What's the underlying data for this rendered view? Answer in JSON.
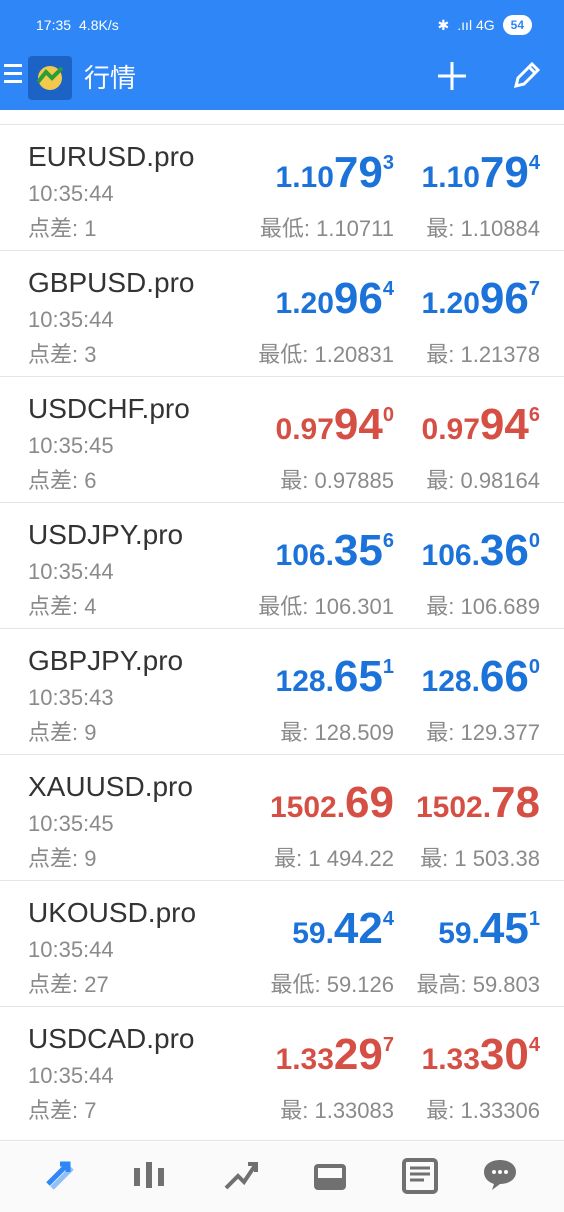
{
  "status_bar": {
    "time": "17:35",
    "speed": "4.8K/s",
    "signal": ".ııl 4G",
    "battery": "54"
  },
  "app_bar": {
    "title": "行情"
  },
  "quotes": [
    {
      "symbol": "EURUSD.pro",
      "time": "10:35:44",
      "spread_label": "点差:",
      "spread": "1",
      "bid": {
        "main": "1.10",
        "big": "79",
        "sup": "3",
        "color": "#1b72d9"
      },
      "ask": {
        "main": "1.10",
        "big": "79",
        "sup": "4",
        "color": "#1b72d9"
      },
      "low_label": "最低:",
      "low": "1.10711",
      "high_label": "最:",
      "high": "1.10884"
    },
    {
      "symbol": "GBPUSD.pro",
      "time": "10:35:44",
      "spread_label": "点差:",
      "spread": "3",
      "bid": {
        "main": "1.20",
        "big": "96",
        "sup": "4",
        "color": "#1b72d9"
      },
      "ask": {
        "main": "1.20",
        "big": "96",
        "sup": "7",
        "color": "#1b72d9"
      },
      "low_label": "最低:",
      "low": "1.20831",
      "high_label": "最:",
      "high": "1.21378"
    },
    {
      "symbol": "USDCHF.pro",
      "time": "10:35:45",
      "spread_label": "点差:",
      "spread": "6",
      "bid": {
        "main": "0.97",
        "big": "94",
        "sup": "0",
        "color": "#d54f45"
      },
      "ask": {
        "main": "0.97",
        "big": "94",
        "sup": "6",
        "color": "#d54f45"
      },
      "low_label": "最:",
      "low": "0.97885",
      "high_label": "最:",
      "high": "0.98164"
    },
    {
      "symbol": "USDJPY.pro",
      "time": "10:35:44",
      "spread_label": "点差:",
      "spread": "4",
      "bid": {
        "main": "106.",
        "big": "35",
        "sup": "6",
        "color": "#1b72d9"
      },
      "ask": {
        "main": "106.",
        "big": "36",
        "sup": "0",
        "color": "#1b72d9"
      },
      "low_label": "最低:",
      "low": "106.301",
      "high_label": "最:",
      "high": "106.689"
    },
    {
      "symbol": "GBPJPY.pro",
      "time": "10:35:43",
      "spread_label": "点差:",
      "spread": "9",
      "bid": {
        "main": "128.",
        "big": "65",
        "sup": "1",
        "color": "#1b72d9"
      },
      "ask": {
        "main": "128.",
        "big": "66",
        "sup": "0",
        "color": "#1b72d9"
      },
      "low_label": "最:",
      "low": "128.509",
      "high_label": "最:",
      "high": "129.377"
    },
    {
      "symbol": "XAUUSD.pro",
      "time": "10:35:45",
      "spread_label": "点差:",
      "spread": "9",
      "bid": {
        "main": "1502.",
        "big": "69",
        "sup": "",
        "color": "#d54f45"
      },
      "ask": {
        "main": "1502.",
        "big": "78",
        "sup": "",
        "color": "#d54f45"
      },
      "low_label": "最:",
      "low": "1 494.22",
      "high_label": "最:",
      "high": "1 503.38"
    },
    {
      "symbol": "UKOUSD.pro",
      "time": "10:35:44",
      "spread_label": "点差:",
      "spread": "27",
      "bid": {
        "main": "59.",
        "big": "42",
        "sup": "4",
        "color": "#1b72d9"
      },
      "ask": {
        "main": "59.",
        "big": "45",
        "sup": "1",
        "color": "#1b72d9"
      },
      "low_label": "最低:",
      "low": "59.126",
      "high_label": "最高:",
      "high": "59.803"
    },
    {
      "symbol": "USDCAD.pro",
      "time": "10:35:44",
      "spread_label": "点差:",
      "spread": "7",
      "bid": {
        "main": "1.33",
        "big": "29",
        "sup": "7",
        "color": "#d54f45"
      },
      "ask": {
        "main": "1.33",
        "big": "30",
        "sup": "4",
        "color": "#d54f45"
      },
      "low_label": "最:",
      "low": "1.33083",
      "high_label": "最:",
      "high": "1.33306"
    }
  ],
  "nav": {
    "active_color": "#2f86f6",
    "inactive_color": "#707070",
    "items": [
      "quotes-icon",
      "chart-icon",
      "trade-icon",
      "history-icon",
      "news-icon",
      "messages-icon"
    ]
  }
}
